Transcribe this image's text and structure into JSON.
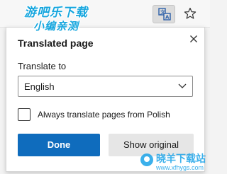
{
  "watermark_top": {
    "line1": "游吧乐下载",
    "line2": "小编亲测"
  },
  "toolbar": {
    "translate_icon": "translate-icon",
    "favorite_icon": "star-icon"
  },
  "popup": {
    "title": "Translated page",
    "close_icon": "close-icon",
    "translate_to_label": "Translate to",
    "language_selected": "English",
    "always_translate_label": "Always translate pages from Polish",
    "always_translate_checked": false,
    "done_label": "Done",
    "show_original_label": "Show original"
  },
  "watermark_bottom": {
    "name": "晓羊下载站",
    "url": "www.xfhygs.com"
  },
  "colors": {
    "primary": "#0f6cbd",
    "watermark": "#16a6de"
  }
}
